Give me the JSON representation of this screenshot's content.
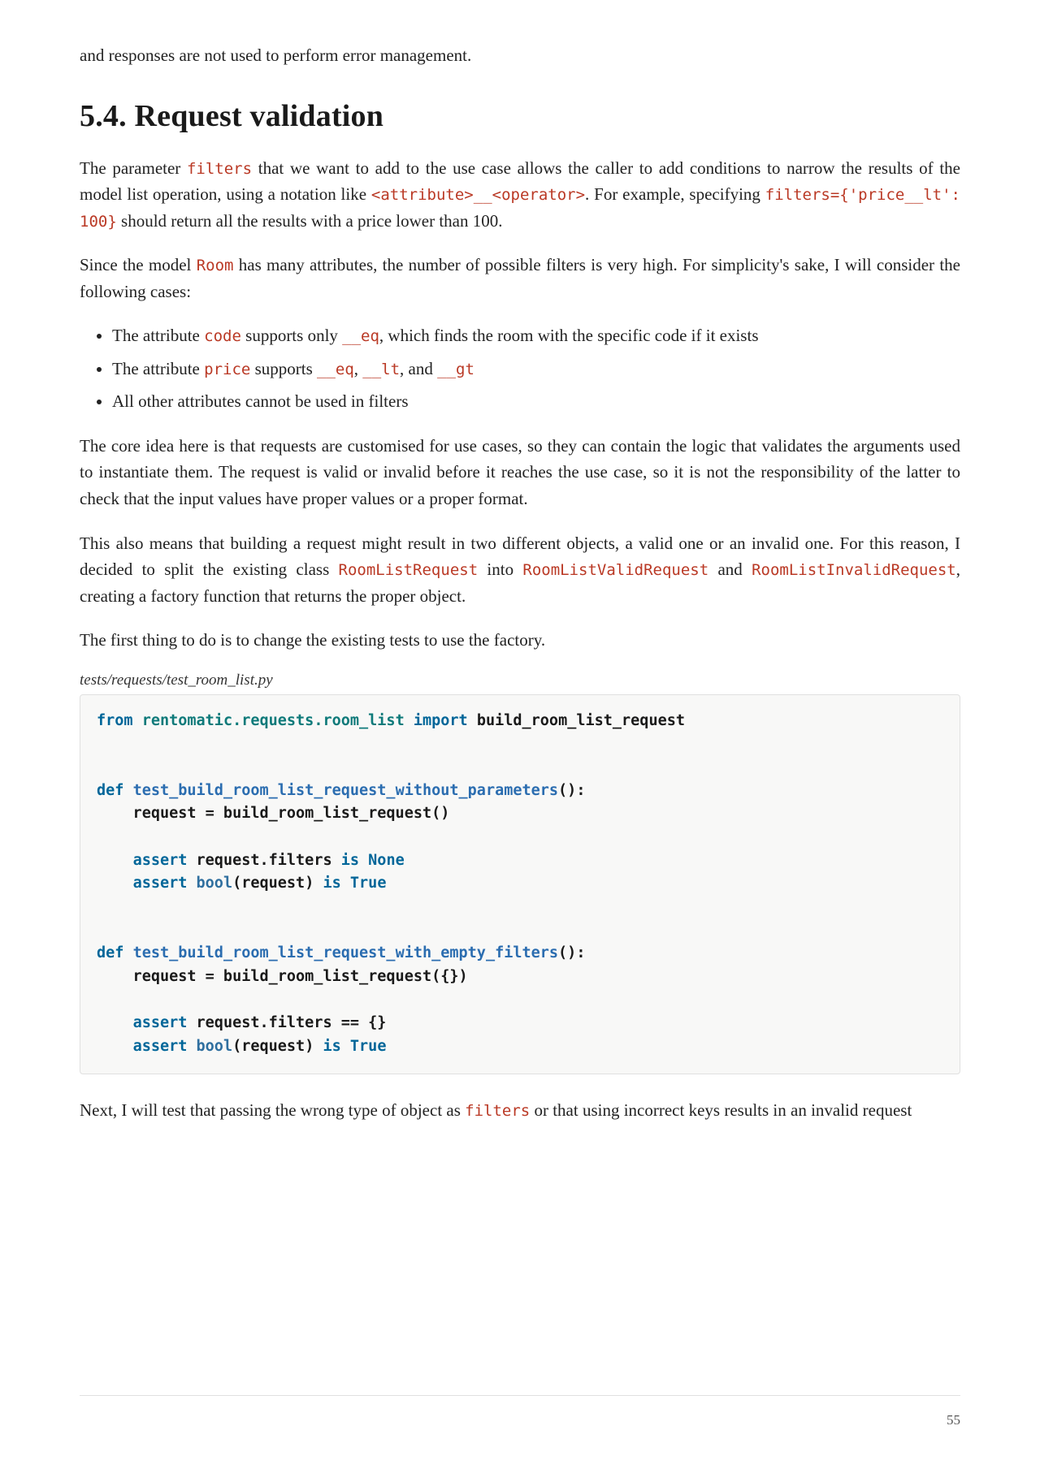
{
  "intro_fragment": "and responses are not used to perform error management.",
  "section": {
    "number": "5.4.",
    "title": "Request validation"
  },
  "para1": {
    "pre_code1": "The parameter ",
    "code1": "filters",
    "mid1": " that we want to add to the use case allows the caller to add conditions to narrow the results of the model list operation, using a notation like ",
    "code2": "<attribute>__<operator>",
    "mid2": ". For example, specifying ",
    "code3": "filters={'price__lt': 100}",
    "tail": " should return all the results with a price lower than 100."
  },
  "para2": {
    "pre": "Since the model ",
    "code1": "Room",
    "tail": " has many attributes, the number of possible filters is very high. For simplicity's sake, I will consider the following cases:"
  },
  "bullets": [
    {
      "pre": "The attribute ",
      "c1": "code",
      "mid": " supports only ",
      "c2": "__eq",
      "tail": ", which finds the room with the specific code if it exists"
    },
    {
      "pre": "The attribute ",
      "c1": "price",
      "mid1": " supports ",
      "c2": "__eq",
      "mid2": ", ",
      "c3": "__lt",
      "mid3": ", and ",
      "c4": "__gt",
      "tail": ""
    },
    {
      "text": "All other attributes cannot be used in filters"
    }
  ],
  "para3": "The core idea here is that requests are customised for use cases, so they can contain the logic that validates the arguments used to instantiate them. The request is valid or invalid before it reaches the use case, so it is not the responsibility of the latter to check that the input values have proper values or a proper format.",
  "para4": {
    "pre": "This also means that building a request might result in two different objects, a valid one or an invalid one. For this reason, I decided to split the existing class ",
    "c1": "RoomListRequest",
    "mid1": " into ",
    "c2": "RoomListValidRequest",
    "mid2": " and ",
    "c3": "RoomListInvalidRequest",
    "tail": ", creating a factory function that returns the proper object."
  },
  "para5": "The first thing to do is to change the existing tests to use the factory.",
  "code_caption": "tests/requests/test_room_list.py",
  "code": {
    "l1_from": "from",
    "l1_mod": "rentomatic.requests.room_list",
    "l1_import": "import",
    "l1_name": "build_room_list_request",
    "l4_def": "def",
    "l4_fn": "test_build_room_list_request_without_parameters",
    "l4_paren": "():",
    "l5": "    request = build_room_list_request()",
    "l7_assert": "assert",
    "l7_rest": " request.filters ",
    "l7_is": "is",
    "l7_none": " None",
    "l8_assert": "assert",
    "l8_sp": " ",
    "l8_bool": "bool",
    "l8_rest": "(request) ",
    "l8_is": "is",
    "l8_true": " True",
    "l11_def": "def",
    "l11_fn": "test_build_room_list_request_with_empty_filters",
    "l11_paren": "():",
    "l12": "    request = build_room_list_request({})",
    "l14_assert": "assert",
    "l14_rest": " request.filters == {}",
    "l15_assert": "assert",
    "l15_sp": " ",
    "l15_bool": "bool",
    "l15_rest": "(request) ",
    "l15_is": "is",
    "l15_true": " True"
  },
  "para6": {
    "pre": "Next, I will test that passing the wrong type of object as ",
    "c1": "filters",
    "tail": " or that using incorrect keys results in an invalid request"
  },
  "page_number": "55"
}
